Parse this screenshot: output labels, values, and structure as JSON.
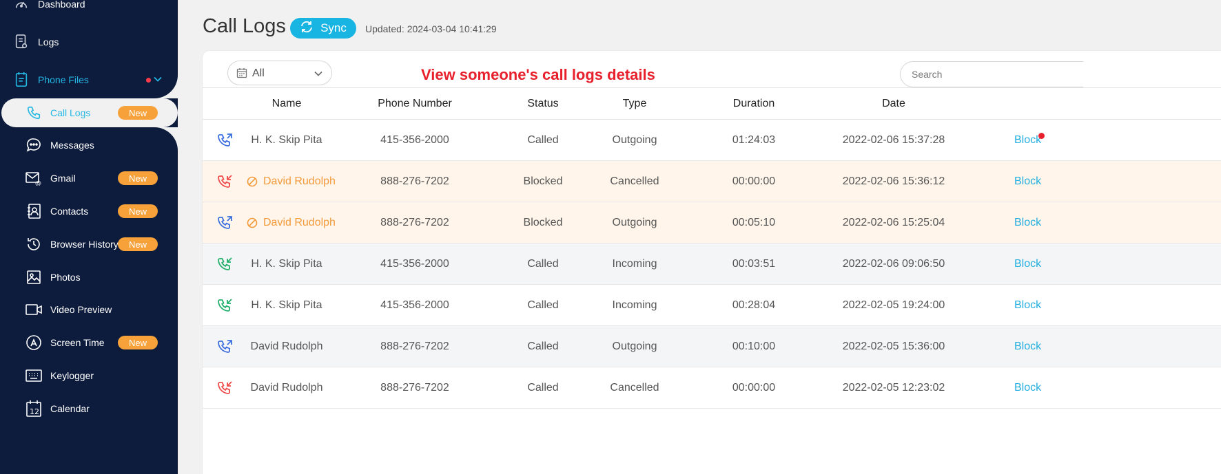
{
  "sidebar": {
    "items": [
      {
        "key": "dashboard",
        "label": "Dashboard",
        "icon": "dashboard-icon",
        "level": "top"
      },
      {
        "key": "logs",
        "label": "Logs",
        "icon": "logs-icon",
        "level": "top"
      },
      {
        "key": "phone_files",
        "label": "Phone Files",
        "icon": "phone-files-icon",
        "level": "top",
        "expanded": true
      },
      {
        "key": "call_logs",
        "label": "Call Logs",
        "icon": "phone-icon",
        "badge": "New",
        "active": true
      },
      {
        "key": "messages",
        "label": "Messages",
        "icon": "message-icon"
      },
      {
        "key": "gmail",
        "label": "Gmail",
        "icon": "gmail-icon",
        "badge": "New"
      },
      {
        "key": "contacts",
        "label": "Contacts",
        "icon": "contacts-icon",
        "badge": "New"
      },
      {
        "key": "browser_history",
        "label": "Browser History",
        "icon": "history-icon",
        "badge": "New"
      },
      {
        "key": "photos",
        "label": "Photos",
        "icon": "photo-icon"
      },
      {
        "key": "video_preview",
        "label": "Video Preview",
        "icon": "video-icon"
      },
      {
        "key": "screen_time",
        "label": "Screen Time",
        "icon": "app-store-icon",
        "badge": "New"
      },
      {
        "key": "keylogger",
        "label": "Keylogger",
        "icon": "keyboard-icon"
      },
      {
        "key": "calendar",
        "label": "Calendar",
        "icon": "calendar-icon"
      }
    ]
  },
  "header": {
    "title": "Call Logs",
    "sync_label": "Sync",
    "updated_text": "Updated: 2024-03-04 10:41:29"
  },
  "filter": {
    "selected": "All"
  },
  "promo_text": "View someone's call logs details",
  "search": {
    "placeholder": "Search"
  },
  "table": {
    "columns": [
      "Name",
      "Phone Number",
      "Status",
      "Type",
      "Duration",
      "Date"
    ],
    "rows": [
      {
        "direction": "outgoing",
        "name": "H. K. Skip Pita",
        "phone": "415-356-2000",
        "status": "Called",
        "type": "Outgoing",
        "duration": "01:24:03",
        "date": "2022-02-06 15:37:28",
        "action": "Block",
        "blocked": false
      },
      {
        "direction": "missed",
        "name": "David Rudolph",
        "phone": "888-276-7202",
        "status": "Blocked",
        "type": "Cancelled",
        "duration": "00:00:00",
        "date": "2022-02-06 15:36:12",
        "action": "Block",
        "blocked": true
      },
      {
        "direction": "outgoing",
        "name": "David Rudolph",
        "phone": "888-276-7202",
        "status": "Blocked",
        "type": "Outgoing",
        "duration": "00:05:10",
        "date": "2022-02-06 15:25:04",
        "action": "Block",
        "blocked": true
      },
      {
        "direction": "incoming",
        "name": "H. K. Skip Pita",
        "phone": "415-356-2000",
        "status": "Called",
        "type": "Incoming",
        "duration": "00:03:51",
        "date": "2022-02-06 09:06:50",
        "action": "Block",
        "blocked": false
      },
      {
        "direction": "incoming",
        "name": "H. K. Skip Pita",
        "phone": "415-356-2000",
        "status": "Called",
        "type": "Incoming",
        "duration": "00:28:04",
        "date": "2022-02-05 19:24:00",
        "action": "Block",
        "blocked": false
      },
      {
        "direction": "outgoing",
        "name": "David Rudolph",
        "phone": "888-276-7202",
        "status": "Called",
        "type": "Outgoing",
        "duration": "00:10:00",
        "date": "2022-02-05 15:36:00",
        "action": "Block",
        "blocked": false
      },
      {
        "direction": "missed",
        "name": "David Rudolph",
        "phone": "888-276-7202",
        "status": "Called",
        "type": "Cancelled",
        "duration": "00:00:00",
        "date": "2022-02-05 12:23:02",
        "action": "Block",
        "blocked": false
      }
    ]
  },
  "colors": {
    "sidebar_bg": "#0d1b3c",
    "accent": "#23b8e3",
    "badge": "#f7a13b",
    "blocked_text": "#f39a3b",
    "promo": "#e8202b",
    "outgoing_icon": "#3d6fe0",
    "incoming_icon": "#22b06b",
    "missed_icon": "#f04a4a"
  }
}
